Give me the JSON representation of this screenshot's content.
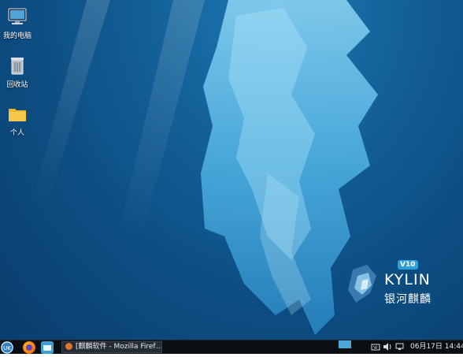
{
  "desktop": {
    "icons": [
      {
        "label": "我的电脑",
        "icon": "computer-icon"
      },
      {
        "label": "回收站",
        "icon": "trash-icon"
      },
      {
        "label": "个人",
        "icon": "folder-icon"
      }
    ]
  },
  "wallpaper": {
    "badge": "V10",
    "brand": "KYLIN",
    "brand_cn": "银河麒麟"
  },
  "taskbar": {
    "tasks": [
      {
        "label": "[麒麟软件 - Mozilla Firef…",
        "icon": "firefox-icon"
      }
    ],
    "clock": "06月17日 14:44"
  },
  "colors": {
    "taskbar": "#0b0f14",
    "accent": "#4ea6d6"
  }
}
